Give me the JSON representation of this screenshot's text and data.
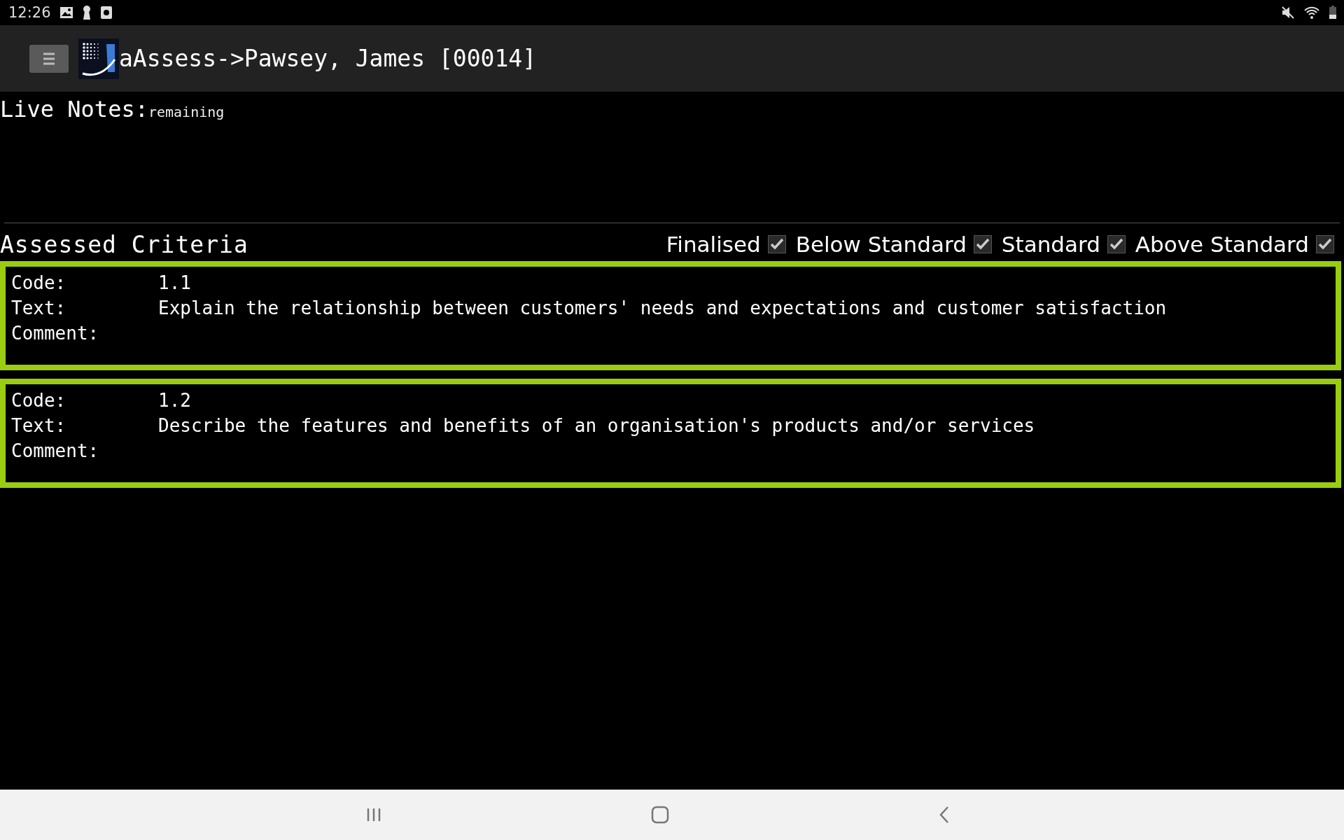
{
  "status_bar": {
    "time": "12:26"
  },
  "header": {
    "title": "aAssess->Pawsey, James [00014]"
  },
  "live_notes": {
    "label": "Live Notes:",
    "hint": "remaining"
  },
  "criteria": {
    "title": "Assessed Criteria",
    "filters": [
      {
        "label": "Finalised",
        "checked": true
      },
      {
        "label": "Below Standard",
        "checked": true
      },
      {
        "label": "Standard",
        "checked": true
      },
      {
        "label": "Above Standard",
        "checked": true
      }
    ],
    "cards": [
      {
        "fields": [
          {
            "label": "Code:",
            "value": "1.1"
          },
          {
            "label": "Text:",
            "value": "Explain the relationship between customers' needs and expectations and customer satisfaction"
          },
          {
            "label": "Comment:"
          }
        ]
      },
      {
        "fields": [
          {
            "label": "Code:",
            "value": "1.2"
          },
          {
            "label": "Text:",
            "value": "Describe the features and benefits of an organisation's products and/or services"
          },
          {
            "label": "Comment:"
          }
        ]
      }
    ]
  }
}
